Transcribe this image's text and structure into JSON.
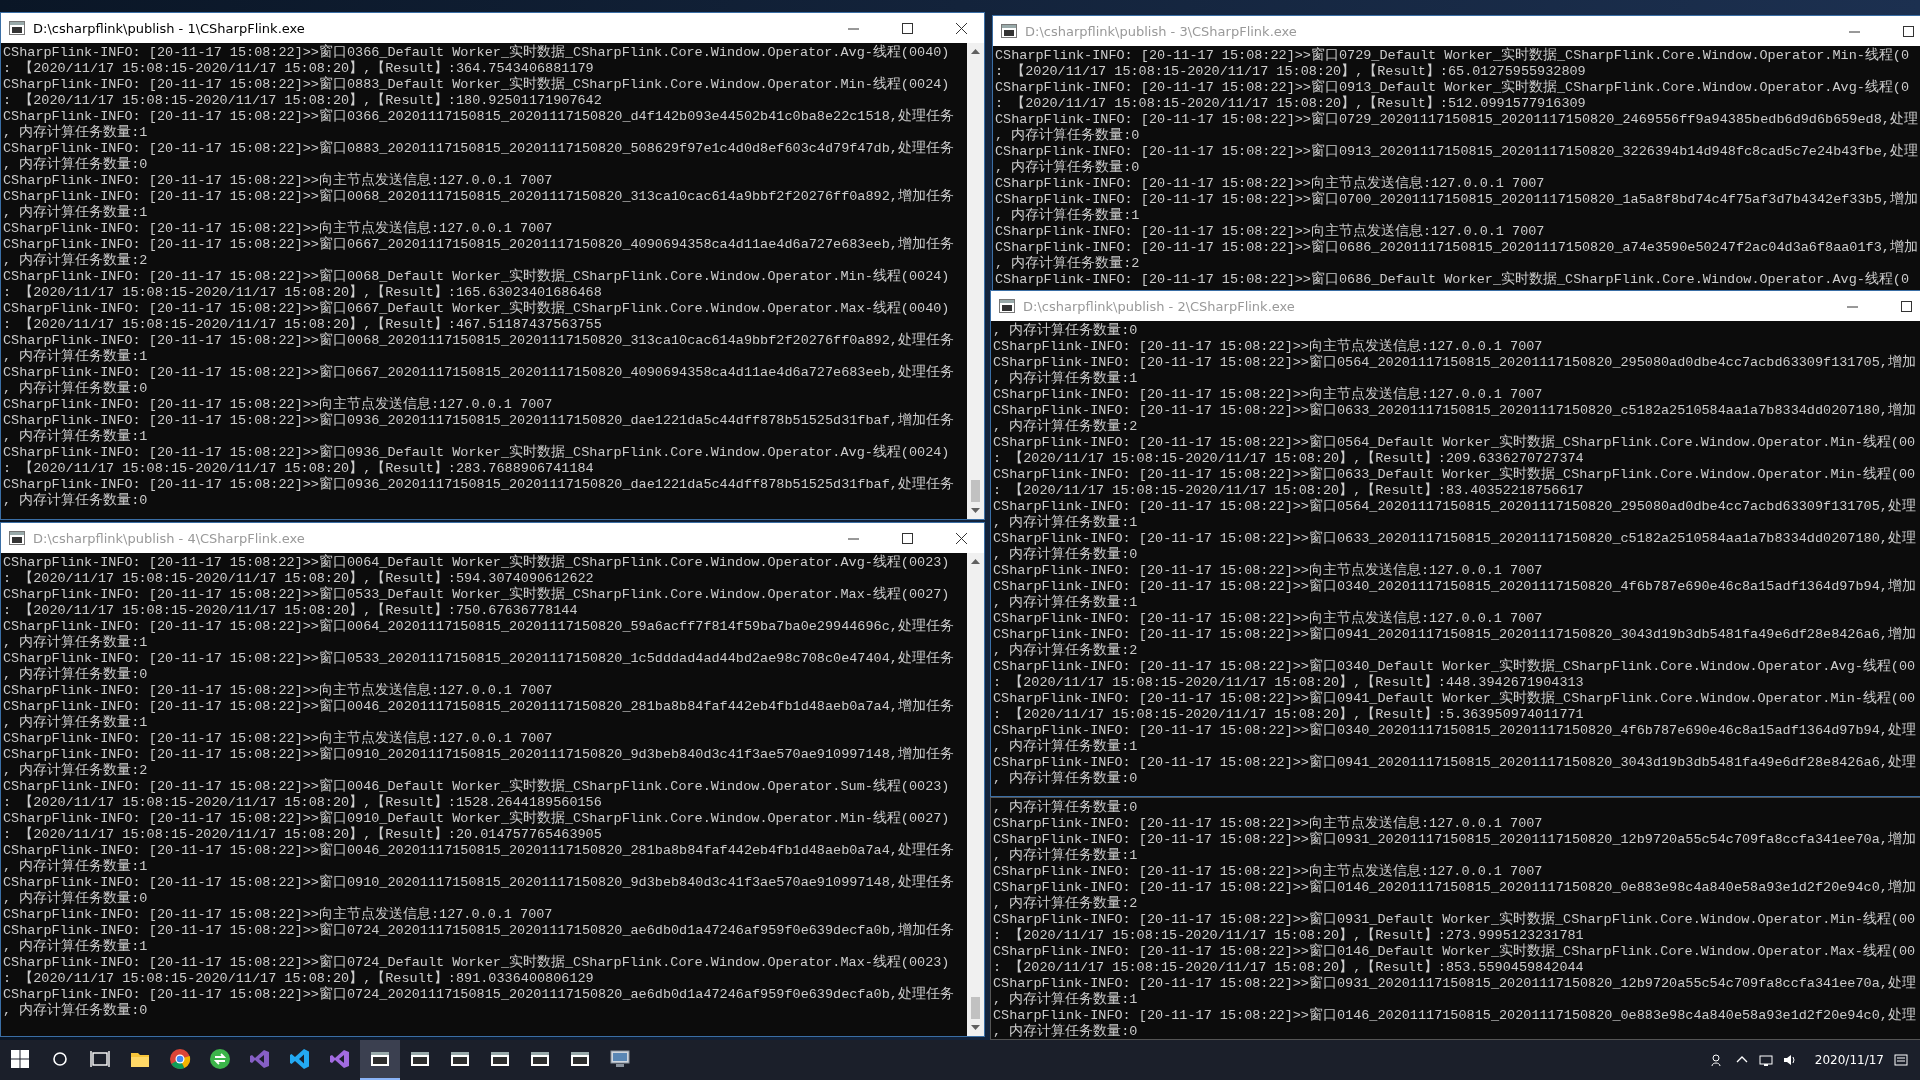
{
  "windows": [
    {
      "title": "D:\\csharpflink\\publish - 1\\CSharpFlink.exe",
      "active": true,
      "controls": [
        {
          "kind": "minimize"
        },
        {
          "kind": "maximize"
        },
        {
          "kind": "close"
        }
      ],
      "scrollbar": true,
      "lines": [
        "CSharpFlink-INFO: [20-11-17 15:08:22]>>窗口0366_Default Worker_实时数据_CSharpFlink.Core.Window.Operator.Avg-线程(0040)",
        ": 【2020/11/17 15:08:15-2020/11/17 15:08:20】,【Result】:364.7543406881179",
        "CSharpFlink-INFO: [20-11-17 15:08:22]>>窗口0883_Default Worker_实时数据_CSharpFlink.Core.Window.Operator.Min-线程(0024)",
        ": 【2020/11/17 15:08:15-2020/11/17 15:08:20】,【Result】:180.92501171907642",
        "CSharpFlink-INFO: [20-11-17 15:08:22]>>窗口0366_20201117150815_20201117150820_d4f142b093e44502b41c0ba8e22c1518,处理任务",
        ", 内存计算任务数量:1",
        "CSharpFlink-INFO: [20-11-17 15:08:22]>>窗口0883_20201117150815_20201117150820_508629f97e1c4d0d8ef603c4d79f47db,处理任务",
        ", 内存计算任务数量:0",
        "CSharpFlink-INFO: [20-11-17 15:08:22]>>向主节点发送信息:127.0.0.1 7007",
        "CSharpFlink-INFO: [20-11-17 15:08:22]>>窗口0068_20201117150815_20201117150820_313ca10cac614a9bbf2f20276ff0a892,增加任务",
        ", 内存计算任务数量:1",
        "CSharpFlink-INFO: [20-11-17 15:08:22]>>向主节点发送信息:127.0.0.1 7007",
        "CSharpFlink-INFO: [20-11-17 15:08:22]>>窗口0667_20201117150815_20201117150820_4090694358ca4d11ae4d6a727e683eeb,增加任务",
        ", 内存计算任务数量:2",
        "CSharpFlink-INFO: [20-11-17 15:08:22]>>窗口0068_Default Worker_实时数据_CSharpFlink.Core.Window.Operator.Min-线程(0024)",
        ": 【2020/11/17 15:08:15-2020/11/17 15:08:20】,【Result】:165.63023401686468",
        "CSharpFlink-INFO: [20-11-17 15:08:22]>>窗口0667_Default Worker_实时数据_CSharpFlink.Core.Window.Operator.Max-线程(0040)",
        ": 【2020/11/17 15:08:15-2020/11/17 15:08:20】,【Result】:467.51187437563755",
        "CSharpFlink-INFO: [20-11-17 15:08:22]>>窗口0068_20201117150815_20201117150820_313ca10cac614a9bbf2f20276ff0a892,处理任务",
        ", 内存计算任务数量:1",
        "CSharpFlink-INFO: [20-11-17 15:08:22]>>窗口0667_20201117150815_20201117150820_4090694358ca4d11ae4d6a727e683eeb,处理任务",
        ", 内存计算任务数量:0",
        "CSharpFlink-INFO: [20-11-17 15:08:22]>>向主节点发送信息:127.0.0.1 7007",
        "CSharpFlink-INFO: [20-11-17 15:08:22]>>窗口0936_20201117150815_20201117150820_dae1221da5c44dff878b51525d31fbaf,增加任务",
        ", 内存计算任务数量:1",
        "CSharpFlink-INFO: [20-11-17 15:08:22]>>窗口0936_Default Worker_实时数据_CSharpFlink.Core.Window.Operator.Avg-线程(0024)",
        ": 【2020/11/17 15:08:15-2020/11/17 15:08:20】,【Result】:283.7688906741184",
        "CSharpFlink-INFO: [20-11-17 15:08:22]>>窗口0936_20201117150815_20201117150820_dae1221da5c44dff878b51525d31fbaf,处理任务",
        ", 内存计算任务数量:0"
      ]
    },
    {
      "title": "D:\\csharpflink\\publish - 3\\CSharpFlink.exe",
      "active": false,
      "controls": [
        {
          "kind": "minimize"
        },
        {
          "kind": "maximize"
        }
      ],
      "lines": [
        "CSharpFlink-INFO: [20-11-17 15:08:22]>>窗口0729_Default Worker_实时数据_CSharpFlink.Core.Window.Operator.Min-线程(0",
        ": 【2020/11/17 15:08:15-2020/11/17 15:08:20】,【Result】:65.01275955932809",
        "CSharpFlink-INFO: [20-11-17 15:08:22]>>窗口0913_Default Worker_实时数据_CSharpFlink.Core.Window.Operator.Avg-线程(0",
        ": 【2020/11/17 15:08:15-2020/11/17 15:08:20】,【Result】:512.0991577916309",
        "CSharpFlink-INFO: [20-11-17 15:08:22]>>窗口0729_20201117150815_20201117150820_2469556ff9a94385bedb6d9d6b659ed8,处理",
        ", 内存计算任务数量:0",
        "CSharpFlink-INFO: [20-11-17 15:08:22]>>窗口0913_20201117150815_20201117150820_3226394b14d948fc8cad5c7e24b43fbe,处理",
        ", 内存计算任务数量:0",
        "CSharpFlink-INFO: [20-11-17 15:08:22]>>向主节点发送信息:127.0.0.1 7007",
        "CSharpFlink-INFO: [20-11-17 15:08:22]>>窗口0700_20201117150815_20201117150820_1a5a8f8bd74c4f75af3d7b4342ef33b5,增加",
        ", 内存计算任务数量:1",
        "CSharpFlink-INFO: [20-11-17 15:08:22]>>向主节点发送信息:127.0.0.1 7007",
        "CSharpFlink-INFO: [20-11-17 15:08:22]>>窗口0686_20201117150815_20201117150820_a74e3590e50247f2ac04d3a6f8aa01f3,增加",
        ", 内存计算任务数量:2",
        "CSharpFlink-INFO: [20-11-17 15:08:22]>>窗口0686_Default Worker_实时数据_CSharpFlink.Core.Window.Operator.Avg-线程(0"
      ]
    },
    {
      "title": "D:\\csharpflink\\publish - 2\\CSharpFlink.exe",
      "active": false,
      "controls": [
        {
          "kind": "minimize"
        },
        {
          "kind": "maximize"
        }
      ],
      "lines": [
        ", 内存计算任务数量:0",
        "CSharpFlink-INFO: [20-11-17 15:08:22]>>向主节点发送信息:127.0.0.1 7007",
        "CSharpFlink-INFO: [20-11-17 15:08:22]>>窗口0564_20201117150815_20201117150820_295080ad0dbe4cc7acbd63309f131705,增加",
        ", 内存计算任务数量:1",
        "CSharpFlink-INFO: [20-11-17 15:08:22]>>向主节点发送信息:127.0.0.1 7007",
        "CSharpFlink-INFO: [20-11-17 15:08:22]>>窗口0633_20201117150815_20201117150820_c5182a2510584aa1a7b8334dd0207180,增加",
        ", 内存计算任务数量:2",
        "CSharpFlink-INFO: [20-11-17 15:08:22]>>窗口0564_Default Worker_实时数据_CSharpFlink.Core.Window.Operator.Min-线程(00",
        ": 【2020/11/17 15:08:15-2020/11/17 15:08:20】,【Result】:209.6336270727374",
        "CSharpFlink-INFO: [20-11-17 15:08:22]>>窗口0633_Default Worker_实时数据_CSharpFlink.Core.Window.Operator.Min-线程(00",
        ": 【2020/11/17 15:08:15-2020/11/17 15:08:20】,【Result】:83.40352218756617",
        "CSharpFlink-INFO: [20-11-17 15:08:22]>>窗口0564_20201117150815_20201117150820_295080ad0dbe4cc7acbd63309f131705,处理",
        ", 内存计算任务数量:1",
        "CSharpFlink-INFO: [20-11-17 15:08:22]>>窗口0633_20201117150815_20201117150820_c5182a2510584aa1a7b8334dd0207180,处理",
        ", 内存计算任务数量:0",
        "CSharpFlink-INFO: [20-11-17 15:08:22]>>向主节点发送信息:127.0.0.1 7007",
        "CSharpFlink-INFO: [20-11-17 15:08:22]>>窗口0340_20201117150815_20201117150820_4f6b787e690e46c8a15adf1364d97b94,增加",
        ", 内存计算任务数量:1",
        "CSharpFlink-INFO: [20-11-17 15:08:22]>>向主节点发送信息:127.0.0.1 7007",
        "CSharpFlink-INFO: [20-11-17 15:08:22]>>窗口0941_20201117150815_20201117150820_3043d19b3db5481fa49e6df28e8426a6,增加",
        ", 内存计算任务数量:2",
        "CSharpFlink-INFO: [20-11-17 15:08:22]>>窗口0340_Default Worker_实时数据_CSharpFlink.Core.Window.Operator.Avg-线程(00",
        ": 【2020/11/17 15:08:15-2020/11/17 15:08:20】,【Result】:448.3942671904313",
        "CSharpFlink-INFO: [20-11-17 15:08:22]>>窗口0941_Default Worker_实时数据_CSharpFlink.Core.Window.Operator.Min-线程(00",
        ": 【2020/11/17 15:08:15-2020/11/17 15:08:20】,【Result】:5.363950974011771",
        "CSharpFlink-INFO: [20-11-17 15:08:22]>>窗口0340_20201117150815_20201117150820_4f6b787e690e46c8a15adf1364d97b94,处理",
        ", 内存计算任务数量:1",
        "CSharpFlink-INFO: [20-11-17 15:08:22]>>窗口0941_20201117150815_20201117150820_3043d19b3db5481fa49e6df28e8426a6,处理",
        ", 内存计算任务数量:0"
      ]
    },
    {
      "title": "D:\\csharpflink\\publish - 4\\CSharpFlink.exe",
      "active": false,
      "controls": [
        {
          "kind": "minimize"
        },
        {
          "kind": "maximize"
        },
        {
          "kind": "close"
        }
      ],
      "scrollbar": true,
      "lines": [
        "CSharpFlink-INFO: [20-11-17 15:08:22]>>窗口0064_Default Worker_实时数据_CSharpFlink.Core.Window.Operator.Avg-线程(0023)",
        ": 【2020/11/17 15:08:15-2020/11/17 15:08:20】,【Result】:594.3074090612622",
        "CSharpFlink-INFO: [20-11-17 15:08:22]>>窗口0533_Default Worker_实时数据_CSharpFlink.Core.Window.Operator.Max-线程(0027)",
        ": 【2020/11/17 15:08:15-2020/11/17 15:08:20】,【Result】:750.67636778144",
        "CSharpFlink-INFO: [20-11-17 15:08:22]>>窗口0064_20201117150815_20201117150820_59a6acff7f814f59ba7ba0e29944696c,处理任务",
        ", 内存计算任务数量:1",
        "CSharpFlink-INFO: [20-11-17 15:08:22]>>窗口0533_20201117150815_20201117150820_1c5dddad4ad44bd2ae98c708c0e47404,处理任务",
        ", 内存计算任务数量:0",
        "CSharpFlink-INFO: [20-11-17 15:08:22]>>向主节点发送信息:127.0.0.1 7007",
        "CSharpFlink-INFO: [20-11-17 15:08:22]>>窗口0046_20201117150815_20201117150820_281ba8b84faf442eb4fb1d48aeb0a7a4,增加任务",
        ", 内存计算任务数量:1",
        "CSharpFlink-INFO: [20-11-17 15:08:22]>>向主节点发送信息:127.0.0.1 7007",
        "CSharpFlink-INFO: [20-11-17 15:08:22]>>窗口0910_20201117150815_20201117150820_9d3beb840d3c41f3ae570ae910997148,增加任务",
        ", 内存计算任务数量:2",
        "CSharpFlink-INFO: [20-11-17 15:08:22]>>窗口0046_Default Worker_实时数据_CSharpFlink.Core.Window.Operator.Sum-线程(0023)",
        ": 【2020/11/17 15:08:15-2020/11/17 15:08:20】,【Result】:1528.2644189560156",
        "CSharpFlink-INFO: [20-11-17 15:08:22]>>窗口0910_Default Worker_实时数据_CSharpFlink.Core.Window.Operator.Min-线程(0027)",
        ": 【2020/11/17 15:08:15-2020/11/17 15:08:20】,【Result】:20.014757765463905",
        "CSharpFlink-INFO: [20-11-17 15:08:22]>>窗口0046_20201117150815_20201117150820_281ba8b84faf442eb4fb1d48aeb0a7a4,处理任务",
        ", 内存计算任务数量:1",
        "CSharpFlink-INFO: [20-11-17 15:08:22]>>窗口0910_20201117150815_20201117150820_9d3beb840d3c41f3ae570ae910997148,处理任务",
        ", 内存计算任务数量:0",
        "CSharpFlink-INFO: [20-11-17 15:08:22]>>向主节点发送信息:127.0.0.1 7007",
        "CSharpFlink-INFO: [20-11-17 15:08:22]>>窗口0724_20201117150815_20201117150820_ae6db0d1a47246af959f0e639decfa0b,增加任务",
        ", 内存计算任务数量:1",
        "CSharpFlink-INFO: [20-11-17 15:08:22]>>窗口0724_Default Worker_实时数据_CSharpFlink.Core.Window.Operator.Max-线程(0023)",
        ": 【2020/11/17 15:08:15-2020/11/17 15:08:20】,【Result】:891.0336400806129",
        "CSharpFlink-INFO: [20-11-17 15:08:22]>>窗口0724_20201117150815_20201117150820_ae6db0d1a47246af959f0e639decfa0b,处理任务",
        ", 内存计算任务数量:0"
      ]
    },
    {
      "lines": [
        ", 内存计算任务数量:0",
        "CSharpFlink-INFO: [20-11-17 15:08:22]>>向主节点发送信息:127.0.0.1 7007",
        "CSharpFlink-INFO: [20-11-17 15:08:22]>>窗口0931_20201117150815_20201117150820_12b9720a55c54c709fa8ccfa341ee70a,增加",
        ", 内存计算任务数量:1",
        "CSharpFlink-INFO: [20-11-17 15:08:22]>>向主节点发送信息:127.0.0.1 7007",
        "CSharpFlink-INFO: [20-11-17 15:08:22]>>窗口0146_20201117150815_20201117150820_0e883e98c4a840e58a93e1d2f20e94c0,增加",
        ", 内存计算任务数量:2",
        "CSharpFlink-INFO: [20-11-17 15:08:22]>>窗口0931_Default Worker_实时数据_CSharpFlink.Core.Window.Operator.Min-线程(00",
        ": 【2020/11/17 15:08:15-2020/11/17 15:08:20】,【Result】:273.9995123231781",
        "CSharpFlink-INFO: [20-11-17 15:08:22]>>窗口0146_Default Worker_实时数据_CSharpFlink.Core.Window.Operator.Max-线程(00",
        ": 【2020/11/17 15:08:15-2020/11/17 15:08:20】,【Result】:853.5590459842044",
        "CSharpFlink-INFO: [20-11-17 15:08:22]>>窗口0931_20201117150815_20201117150820_12b9720a55c54c709fa8ccfa341ee70a,处理",
        ", 内存计算任务数量:1",
        "CSharpFlink-INFO: [20-11-17 15:08:22]>>窗口0146_20201117150815_20201117150820_0e883e98c4a840e58a93e1d2f20e94c0,处理",
        ", 内存计算任务数量:0"
      ]
    }
  ],
  "taskbar": {
    "apps": [
      {
        "kind": "start",
        "selected": false
      },
      {
        "kind": "search",
        "selected": false
      },
      {
        "kind": "taskview",
        "selected": false
      },
      {
        "kind": "explorer",
        "selected": false
      },
      {
        "kind": "browser",
        "selected": false
      },
      {
        "kind": "green",
        "selected": false
      },
      {
        "kind": "vs",
        "selected": false
      },
      {
        "kind": "vscode",
        "selected": false
      },
      {
        "kind": "vs2",
        "selected": false
      },
      {
        "kind": "console",
        "selected": true
      },
      {
        "kind": "console",
        "selected": false
      },
      {
        "kind": "console",
        "selected": false
      },
      {
        "kind": "console",
        "selected": false
      },
      {
        "kind": "console",
        "selected": false
      },
      {
        "kind": "console",
        "selected": false
      },
      {
        "kind": "monitor",
        "selected": false
      }
    ],
    "date": "2020/11/17"
  }
}
